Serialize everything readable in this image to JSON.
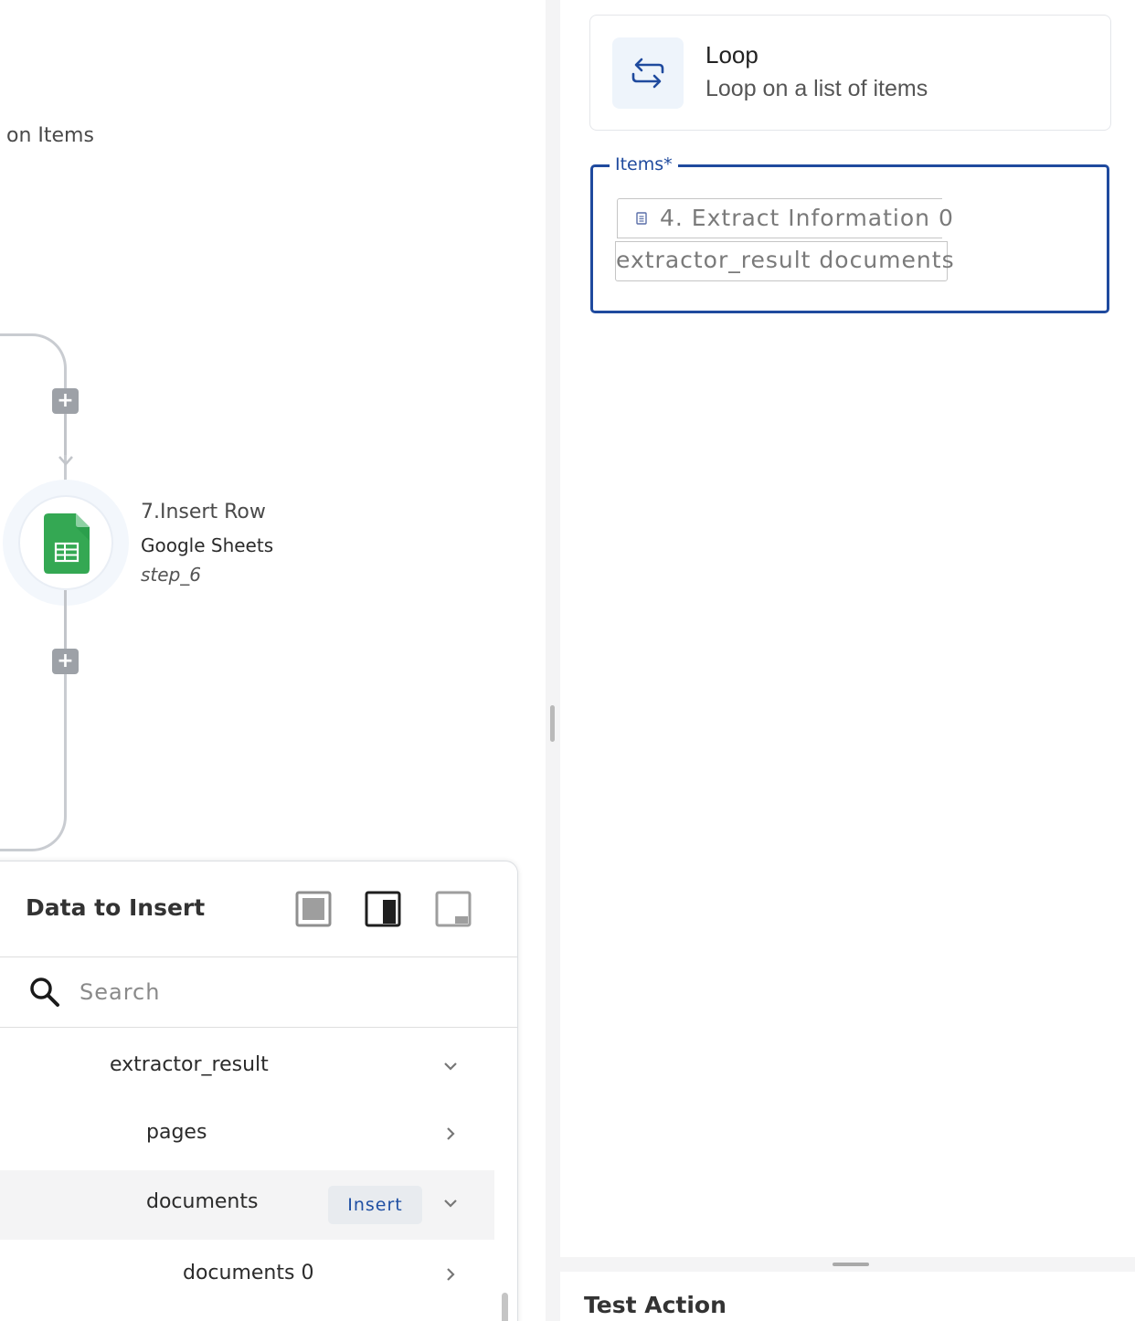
{
  "canvas": {
    "loop_label": "on Items",
    "step": {
      "title": "7.Insert Row",
      "app": "Google Sheets",
      "id": "step_6"
    },
    "add_step_symbol": "+"
  },
  "data_panel": {
    "title": "Data to Insert",
    "search": {
      "placeholder": "Search",
      "value": ""
    },
    "view_modes": [
      "view-mode-full-icon",
      "view-mode-dock-icon",
      "view-mode-collapsed-icon"
    ],
    "items": [
      {
        "label": "extractor_result",
        "state": "expanded"
      },
      {
        "label": "pages",
        "state": "collapsed"
      },
      {
        "label": "documents",
        "state": "expanded",
        "action": "Insert"
      },
      {
        "label": "documents 0",
        "state": "collapsed"
      }
    ]
  },
  "config": {
    "action": {
      "title": "Loop",
      "subtitle": "Loop on a list of items",
      "icon": "loop-arrows-icon"
    },
    "items_field": {
      "label": "Items*",
      "chip_line1": "4. Extract Information 0",
      "chip_line2": "extractor_result documents"
    }
  },
  "test_panel": {
    "title": "Test Action"
  },
  "colors": {
    "accent": "#1f4a9e",
    "insert_text": "#1f4fa3",
    "sheets_green": "#34a853",
    "plus_button": "#9da1a7",
    "divider": "#f4f4f5"
  }
}
